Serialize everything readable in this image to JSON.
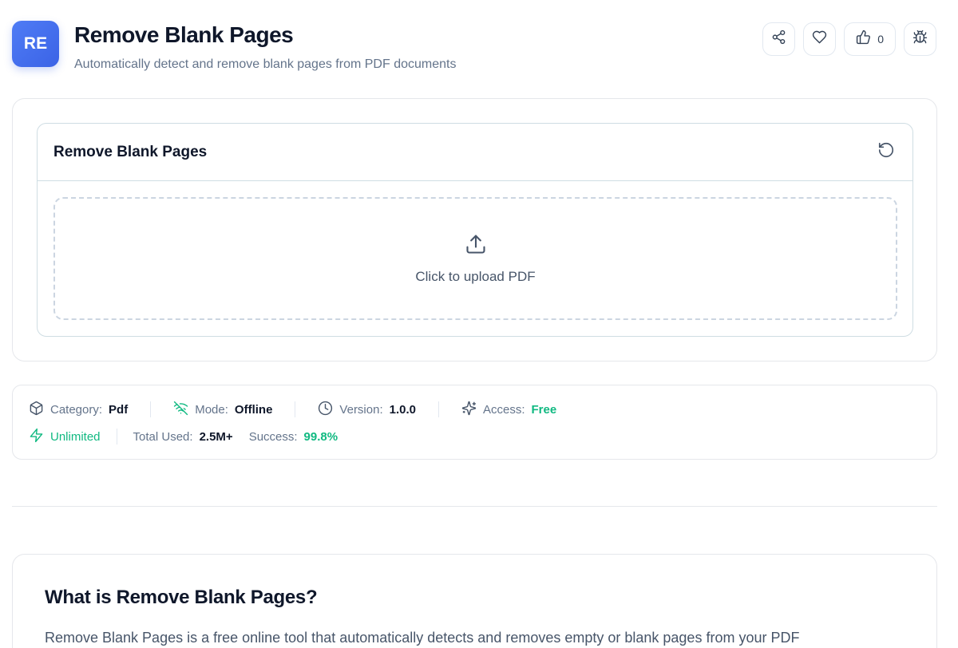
{
  "header": {
    "badge": "RE",
    "title": "Remove Blank Pages",
    "subtitle": "Automatically detect and remove blank pages from PDF documents",
    "actions": {
      "share_icon": "share-icon",
      "favorite_icon": "heart-icon",
      "like_icon": "thumbs-up-icon",
      "like_count": "0",
      "report_icon": "bug-icon"
    }
  },
  "tool": {
    "title": "Remove Blank Pages",
    "reset_icon": "reset-icon",
    "upload_icon": "upload-icon",
    "upload_text": "Click to upload PDF"
  },
  "meta": {
    "category_label": "Category:",
    "category_value": "Pdf",
    "mode_label": "Mode:",
    "mode_value": "Offline",
    "version_label": "Version:",
    "version_value": "1.0.0",
    "access_label": "Access:",
    "access_value": "Free",
    "unlimited": "Unlimited",
    "total_used_label": "Total Used:",
    "total_used_value": "2.5M+",
    "success_label": "Success:",
    "success_value": "99.8%"
  },
  "about": {
    "title": "What is Remove Blank Pages?",
    "text": "Remove Blank Pages is a free online tool that automatically detects and removes empty or blank pages from your PDF"
  },
  "colors": {
    "accent": "#3b63e6",
    "success": "#10b981"
  }
}
